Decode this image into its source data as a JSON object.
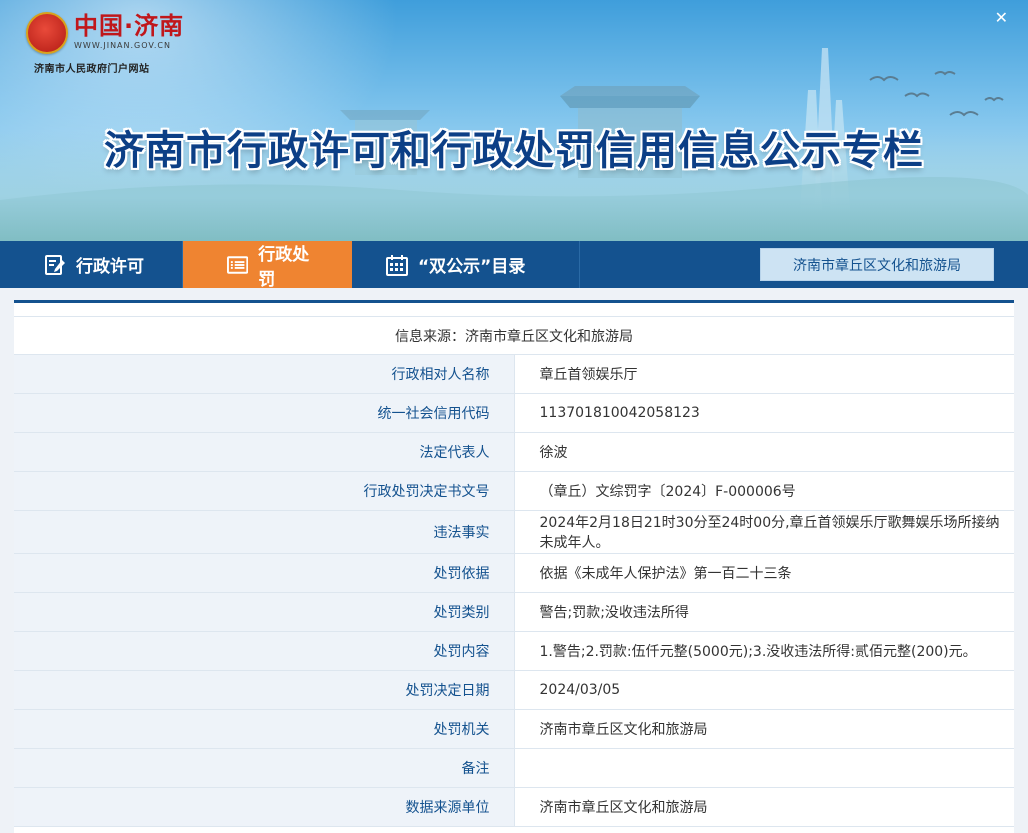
{
  "header": {
    "logo_text": "中国·济南",
    "logo_url": "WWW.JINAN.GOV.CN",
    "logo_sub": "济南市人民政府门户网站",
    "title": "济南市行政许可和行政处罚信用信息公示专栏",
    "close_icon": "close-icon"
  },
  "nav": {
    "items": [
      {
        "label": "行政许可",
        "icon": "edit-icon",
        "active": false
      },
      {
        "label": "行政处罚",
        "icon": "list-icon",
        "active": true
      },
      {
        "label": "“双公示”目录",
        "icon": "calendar-icon",
        "active": false
      }
    ],
    "dept": "济南市章丘区文化和旅游局"
  },
  "record": {
    "source": "信息来源：济南市章丘区文化和旅游局",
    "rows": [
      {
        "label": "行政相对人名称",
        "value": "章丘首领娱乐厅"
      },
      {
        "label": "统一社会信用代码",
        "value": "113701810042058123"
      },
      {
        "label": "法定代表人",
        "value": "徐波"
      },
      {
        "label": "行政处罚决定书文号",
        "value": "（章丘）文综罚字〔2024〕F-000006号"
      },
      {
        "label": "违法事实",
        "value": "2024年2月18日21时30分至24时00分,章丘首领娱乐厅歌舞娱乐场所接纳未成年人。"
      },
      {
        "label": "处罚依据",
        "value": "依据《未成年人保护法》第一百二十三条"
      },
      {
        "label": "处罚类别",
        "value": "警告;罚款;没收违法所得"
      },
      {
        "label": "处罚内容",
        "value": "1.警告;2.罚款:伍仟元整(5000元);3.没收违法所得:贰佰元整(200)元。"
      },
      {
        "label": "处罚决定日期",
        "value": "2024/03/05"
      },
      {
        "label": "处罚机关",
        "value": "济南市章丘区文化和旅游局"
      },
      {
        "label": "备注",
        "value": ""
      },
      {
        "label": "数据来源单位",
        "value": "济南市章丘区文化和旅游局"
      }
    ]
  },
  "colors": {
    "nav_bg": "#14528f",
    "nav_active": "#ef8431",
    "label_text": "#14528f",
    "label_bg": "#eef3f9",
    "title_text": "#0c3f86"
  }
}
